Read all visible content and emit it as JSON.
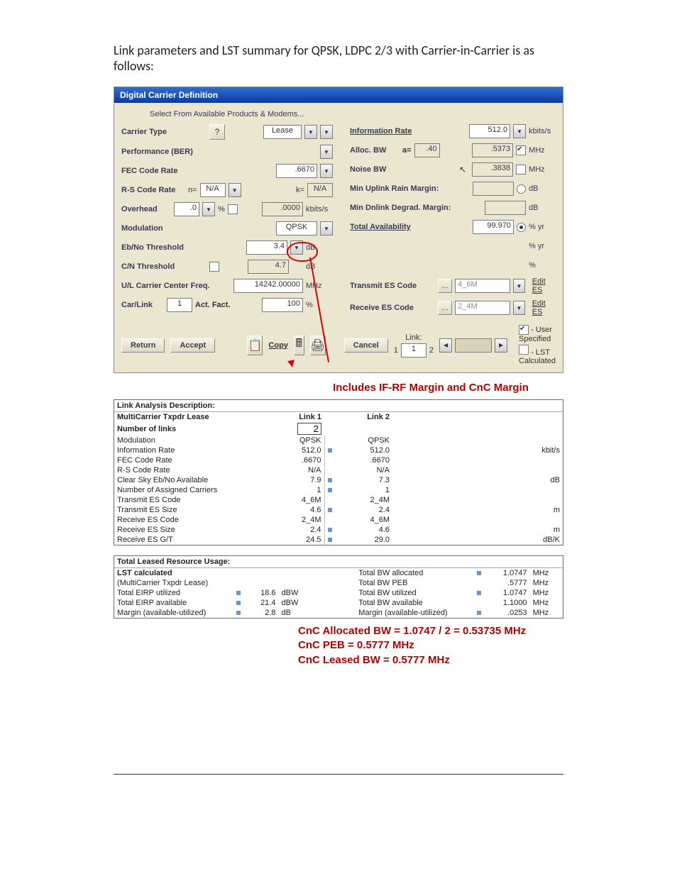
{
  "intro_text": "Link parameters and LST summary for QPSK, LDPC 2/3 with Carrier-in-Carrier is as follows:",
  "dcd": {
    "title": "Digital Carrier Definition",
    "select_label": "Select From Available Products & Modems...",
    "left": {
      "carrier_type": {
        "label": "Carrier Type",
        "value": "Lease"
      },
      "perf_ber": {
        "label": "Performance (BER)"
      },
      "fec": {
        "label": "FEC Code Rate",
        "value": ".6670"
      },
      "rs": {
        "label": "R-S Code Rate",
        "n_label": "n=",
        "n_value": "N/A",
        "k_label": "k=",
        "k_value": "N/A"
      },
      "overhead": {
        "label": "Overhead",
        "v1": ".0",
        "unit1": "%",
        "v2": ".0000",
        "unit2": "kbits/s"
      },
      "modulation": {
        "label": "Modulation",
        "value": "QPSK"
      },
      "ebno": {
        "label": "Eb/No Threshold",
        "value": "3.4",
        "unit": "dB"
      },
      "cn": {
        "label": "C/N Threshold",
        "value": "4.7",
        "unit": "dB"
      },
      "ulfreq": {
        "label": "U/L Carrier Center Freq.",
        "value": "14242.00000",
        "unit": "MHz"
      },
      "carlink": {
        "label": "Car/Link",
        "v1": "1",
        "act_label": "Act. Fact.",
        "v2": "100",
        "unit": "%"
      }
    },
    "right": {
      "info_rate": {
        "label": "Information Rate",
        "value": "512.0",
        "unit": "kbits/s"
      },
      "alloc_bw": {
        "label": "Alloc. BW",
        "a_label": "a=",
        "a_value": ".40",
        "value": ".5373",
        "unit": "MHz"
      },
      "noise_bw": {
        "label": "Noise BW",
        "value": ".3838",
        "unit": "MHz"
      },
      "ul_margin": {
        "label": "Min Uplink Rain Margin:",
        "unit": "dB"
      },
      "dl_margin": {
        "label": "Min Dnlink Degrad. Margin:",
        "unit": "dB"
      },
      "avail": {
        "label": "Total Availability",
        "value": "99.970",
        "unit": "% yr"
      },
      "avail2": {
        "unit": "% yr"
      },
      "avail3": {
        "unit": "%"
      },
      "tx_es": {
        "label": "Transmit ES Code",
        "value": "4_6M",
        "edit": "Edit ES"
      },
      "rx_es": {
        "label": "Receive ES Code",
        "value": "2_4M",
        "edit": "Edit ES"
      }
    },
    "buttons": {
      "return": "Return",
      "accept": "Accept",
      "copy": "Copy"
    },
    "link_section": {
      "label": "Link:",
      "num": "1",
      "total_left": "1",
      "total_right": "2",
      "cancel": "Cancel"
    },
    "legend": {
      "user": "- User Specified",
      "lst": "- LST Calculated"
    }
  },
  "annotation1": "Includes IF-RF Margin and CnC Margin",
  "lad": {
    "title": "Link Analysis Description:",
    "header1": "MultiCarrier Txpdr Lease",
    "col1": "Link 1",
    "col2": "Link 2",
    "rows": [
      {
        "label": "Number of links",
        "v1_input": "2",
        "unit": ""
      },
      {
        "label": "Modulation",
        "v1": "QPSK",
        "v2": "QPSK",
        "unit": ""
      },
      {
        "label": "Information Rate",
        "v1": "512.0",
        "v2": "512.0",
        "unit": "kbit/s",
        "crn": true
      },
      {
        "label": "FEC Code Rate",
        "v1": ".6670",
        "v2": ".6670",
        "unit": ""
      },
      {
        "label": "R-S Code Rate",
        "v1": "N/A",
        "v2": "N/A",
        "unit": ""
      },
      {
        "label": "Clear Sky Eb/No Available",
        "v1": "7.9",
        "v2": "7.3",
        "unit": "dB",
        "crn": true
      },
      {
        "label": "Number of Assigned Carriers",
        "v1": "1",
        "v2": "1",
        "unit": "",
        "crn": true
      },
      {
        "label": "Transmit ES Code",
        "v1": "4_6M",
        "v2": "2_4M",
        "unit": ""
      },
      {
        "label": "Transmit ES Size",
        "v1": "4.6",
        "v2": "2.4",
        "unit": "m",
        "crn": true
      },
      {
        "label": "Receive ES Code",
        "v1": "2_4M",
        "v2": "4_6M",
        "unit": ""
      },
      {
        "label": "Receive ES Size",
        "v1": "2.4",
        "v2": "4.6",
        "unit": "m",
        "crn": true
      },
      {
        "label": "Receive ES G/T",
        "v1": "24.5",
        "v2": "29.0",
        "unit": "dB/K",
        "crn": true
      }
    ]
  },
  "tlr": {
    "title": "Total Leased Resource Usage:",
    "lst_calc": "LST calculated",
    "lst_sub": "(MultiCarrier Txpdr Lease)",
    "left": [
      {
        "label": "Total EIRP utilized",
        "val": "18.6",
        "unit": "dBW"
      },
      {
        "label": "Total EIRP available",
        "val": "21.4",
        "unit": "dBW"
      },
      {
        "label": "Margin (available-utilized)",
        "val": "2.8",
        "unit": "dB"
      }
    ],
    "right": [
      {
        "label": "Total BW allocated",
        "val": "1.0747",
        "unit": "MHz"
      },
      {
        "label": "Total BW PEB",
        "val": ".5777",
        "unit": "MHz"
      },
      {
        "label": "Total BW utilized",
        "val": "1.0747",
        "unit": "MHz"
      },
      {
        "label": "Total BW available",
        "val": "1.1000",
        "unit": "MHz"
      },
      {
        "label": "Margin (available-utilized)",
        "val": ".0253",
        "unit": "MHz"
      }
    ]
  },
  "annotation_block": {
    "line1": "CnC Allocated BW = 1.0747 / 2 = 0.53735 MHz",
    "line2": "CnC PEB = 0.5777 MHz",
    "line3": "CnC Leased BW = 0.5777 MHz"
  }
}
